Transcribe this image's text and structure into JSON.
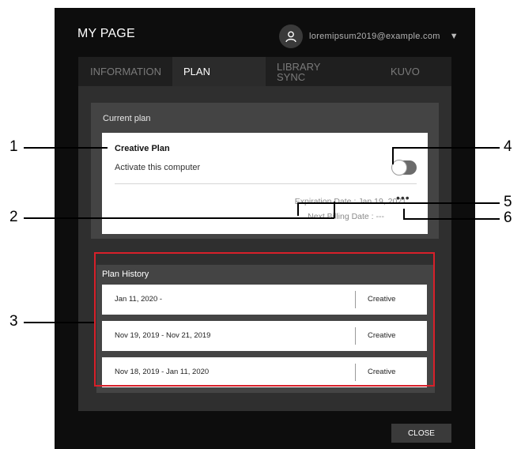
{
  "dialog": {
    "title": "MY PAGE",
    "username": "loremipsum2019@example.com",
    "close_label": "CLOSE"
  },
  "tabs": [
    {
      "label": "INFORMATION",
      "active": false
    },
    {
      "label": "PLAN",
      "active": true
    },
    {
      "label": "LIBRARY\nSYNC",
      "active": false
    },
    {
      "label": "KUVO",
      "active": false
    }
  ],
  "current_plan": {
    "section_label": "Current plan",
    "plan_name": "Creative Plan",
    "activate_label": "Activate this computer",
    "activate_on": false,
    "expiration": "Expiration Date : Jan 19, 2021",
    "next_billing": "Next Billing Date : ---",
    "more_label": "•••"
  },
  "plan_history": {
    "section_label": "Plan History",
    "rows": [
      {
        "dates": "Jan 11, 2020 -",
        "plan": "Creative"
      },
      {
        "dates": "Nov 19, 2019 - Nov 21, 2019",
        "plan": "Creative"
      },
      {
        "dates": "Nov 18, 2019 - Jan 11, 2020",
        "plan": "Creative"
      }
    ]
  },
  "callouts": [
    "1",
    "2",
    "3",
    "4",
    "5",
    "6"
  ],
  "colors": {
    "dialog_bg": "#0d0d0d",
    "highlight": "#d8202a"
  },
  "icons": {
    "avatar": "user-icon",
    "dropdown": "caret-down-icon"
  }
}
